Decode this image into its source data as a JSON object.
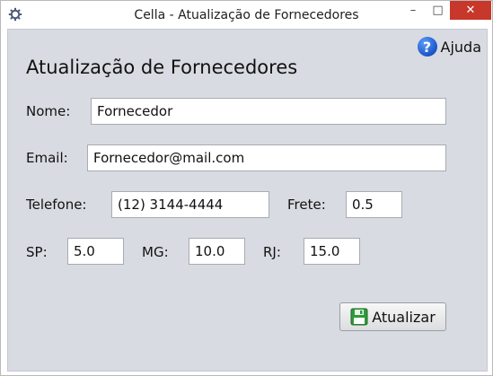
{
  "window": {
    "title": "Cella - Atualização de Fornecedores",
    "minimize_glyph": "–",
    "maximize_glyph": "□",
    "close_glyph": "✕",
    "close_color": "#c7372a"
  },
  "help": {
    "glyph": "?",
    "label": "Ajuda",
    "icon": "help-icon"
  },
  "form": {
    "heading": "Atualização de Fornecedores",
    "nome_label": "Nome:",
    "nome_value": "Fornecedor",
    "email_label": "Email:",
    "email_value": "Fornecedor@mail.com",
    "telefone_label": "Telefone:",
    "telefone_value": "(12) 3144-4444",
    "frete_label": "Frete:",
    "frete_value": "0.5",
    "sp_label": "SP:",
    "sp_value": "5.0",
    "mg_label": "MG:",
    "mg_value": "10.0",
    "rj_label": "RJ:",
    "rj_value": "15.0"
  },
  "actions": {
    "update_label": "Atualizar",
    "update_icon": "save-icon"
  },
  "colors": {
    "panel_bg": "#d9dbe2",
    "save_icon_green": "#2f9a3a"
  }
}
